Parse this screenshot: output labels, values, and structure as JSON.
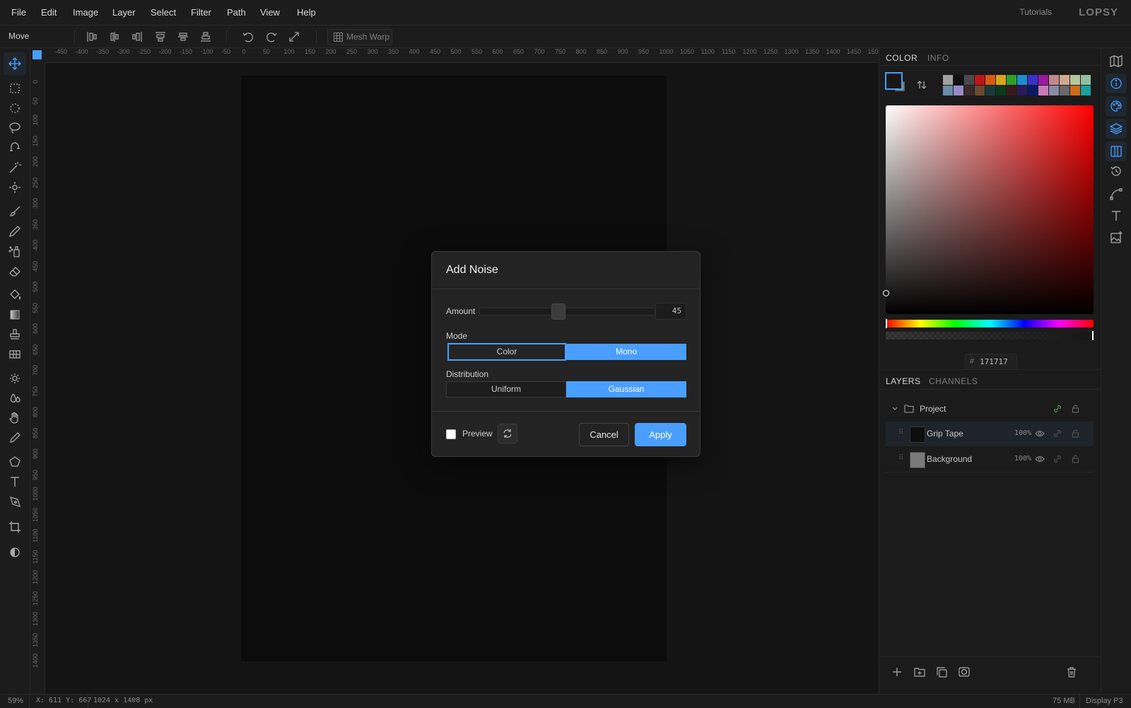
{
  "menu": {
    "items": [
      "File",
      "Edit",
      "Image",
      "Layer",
      "Select",
      "Filter",
      "Path",
      "View",
      "Help"
    ],
    "tutorials": "Tutorials",
    "logo": "LOPSY"
  },
  "options_bar": {
    "tool_name": "Move",
    "mesh_warp_label": "Mesh Warp"
  },
  "rulers": {
    "horizontal": [
      "-450",
      "-400",
      "-350",
      "-300",
      "-250",
      "-200",
      "-150",
      "-100",
      "-50",
      "0",
      "50",
      "100",
      "150",
      "200",
      "250",
      "300",
      "350",
      "400",
      "450",
      "500",
      "550",
      "600",
      "650",
      "700",
      "750",
      "800",
      "850",
      "900",
      "950",
      "1000",
      "1050",
      "1100",
      "1150",
      "1200",
      "1250",
      "1300",
      "1350",
      "1400",
      "1450",
      "150"
    ],
    "vertical": [
      "0",
      "50",
      "100",
      "150",
      "200",
      "250",
      "300",
      "350",
      "400",
      "450",
      "500",
      "550",
      "600",
      "650",
      "700",
      "750",
      "800",
      "850",
      "900",
      "950",
      "1000",
      "1050",
      "1100",
      "1150",
      "1200",
      "1250",
      "1300",
      "1350",
      "1400"
    ]
  },
  "dialog": {
    "title": "Add Noise",
    "amount_label": "Amount",
    "amount_value": "45",
    "amount_fraction": 0.45,
    "mode_label": "Mode",
    "mode_options": [
      "Color",
      "Mono"
    ],
    "mode_selected": "Mono",
    "distribution_label": "Distribution",
    "distribution_options": [
      "Uniform",
      "Gaussian"
    ],
    "distribution_selected": "Gaussian",
    "preview_label": "Preview",
    "preview_checked": false,
    "cancel_label": "Cancel",
    "apply_label": "Apply"
  },
  "color_panel": {
    "tabs": [
      "COLOR",
      "INFO"
    ],
    "active_tab": "COLOR",
    "hex_prefix": "#",
    "hex_value": "171717",
    "swatches": [
      "#a0a0a0",
      "#111111",
      "#4a4a4a",
      "#c0141a",
      "#d85a12",
      "#d8a61c",
      "#2ea02a",
      "#1a8ed0",
      "#3a32c8",
      "#9a1aa0",
      "#c08a8a",
      "#d0a890",
      "#b8c4a0",
      "#90c0a0",
      "#6a8ca8",
      "#9a8ac8",
      "#3a2a2a",
      "#6a4a2a",
      "#1a3a3a",
      "#0a3a1a",
      "#3a1a1a",
      "#2a1a5a",
      "#0a1a6a",
      "#c87ab8",
      "#8a8aa8",
      "#6a6a6a",
      "#d06a1a",
      "#1aa0a0"
    ],
    "hue_gradient": [
      "#ff0000",
      "#ffff00",
      "#00ff00",
      "#00ffff",
      "#0000ff",
      "#ff00ff",
      "#ff0000"
    ]
  },
  "layers_panel": {
    "tabs": [
      "LAYERS",
      "CHANNELS"
    ],
    "active_tab": "LAYERS",
    "group_name": "Project",
    "layers": [
      {
        "name": "Grip Tape",
        "opacity": "100%",
        "selected": true
      },
      {
        "name": "Background",
        "opacity": "100%",
        "selected": false
      }
    ]
  },
  "status": {
    "zoom": "59%",
    "coords": "X: 611 Y: 667",
    "doc_size": "1024 x 1408 px",
    "memory": "75 MB",
    "color_profile": "Display P3"
  },
  "colors": {
    "accent": "#4a9eff",
    "background": "#191919",
    "dialog_bg": "#232323"
  }
}
